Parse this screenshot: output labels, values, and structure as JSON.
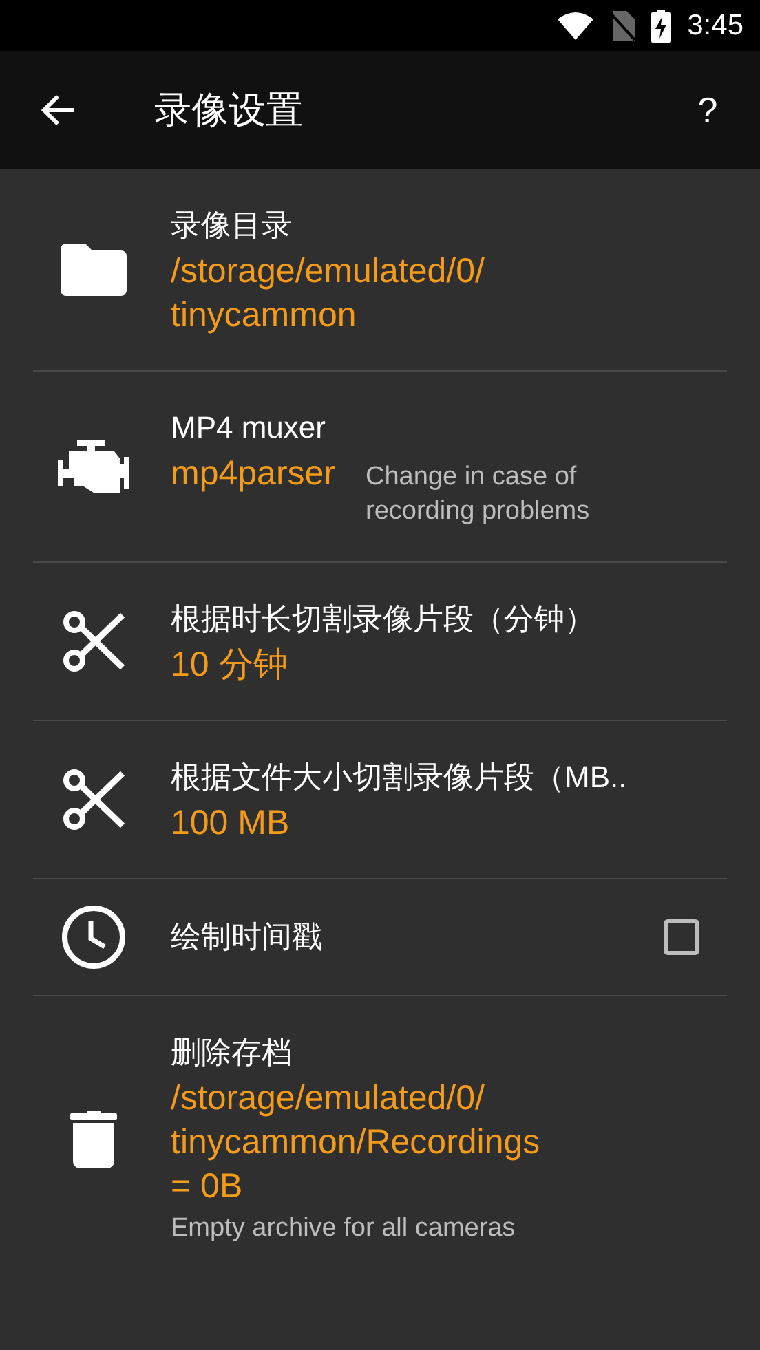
{
  "status_bar": {
    "time": "3:45"
  },
  "toolbar": {
    "title": "录像设置",
    "help": "?"
  },
  "settings": [
    {
      "kind": "value",
      "title": "录像目录",
      "value": "/storage/emulated/0/\ntinycammon"
    },
    {
      "kind": "value",
      "title": "MP4 muxer",
      "value": "mp4parser",
      "hint": "Change in case of\nrecording problems"
    },
    {
      "kind": "value",
      "title": "根据时长切割录像片段（分钟）",
      "value": "10 分钟"
    },
    {
      "kind": "value",
      "title": "根据文件大小切割录像片段（MB..",
      "value": "100 MB"
    },
    {
      "kind": "checkbox",
      "title": "绘制时间戳",
      "checked": false
    },
    {
      "kind": "value",
      "title": "删除存档",
      "value": "/storage/emulated/0/\ntinycammon/Recordings\n= 0B",
      "summary": "Empty archive for all cameras"
    }
  ]
}
